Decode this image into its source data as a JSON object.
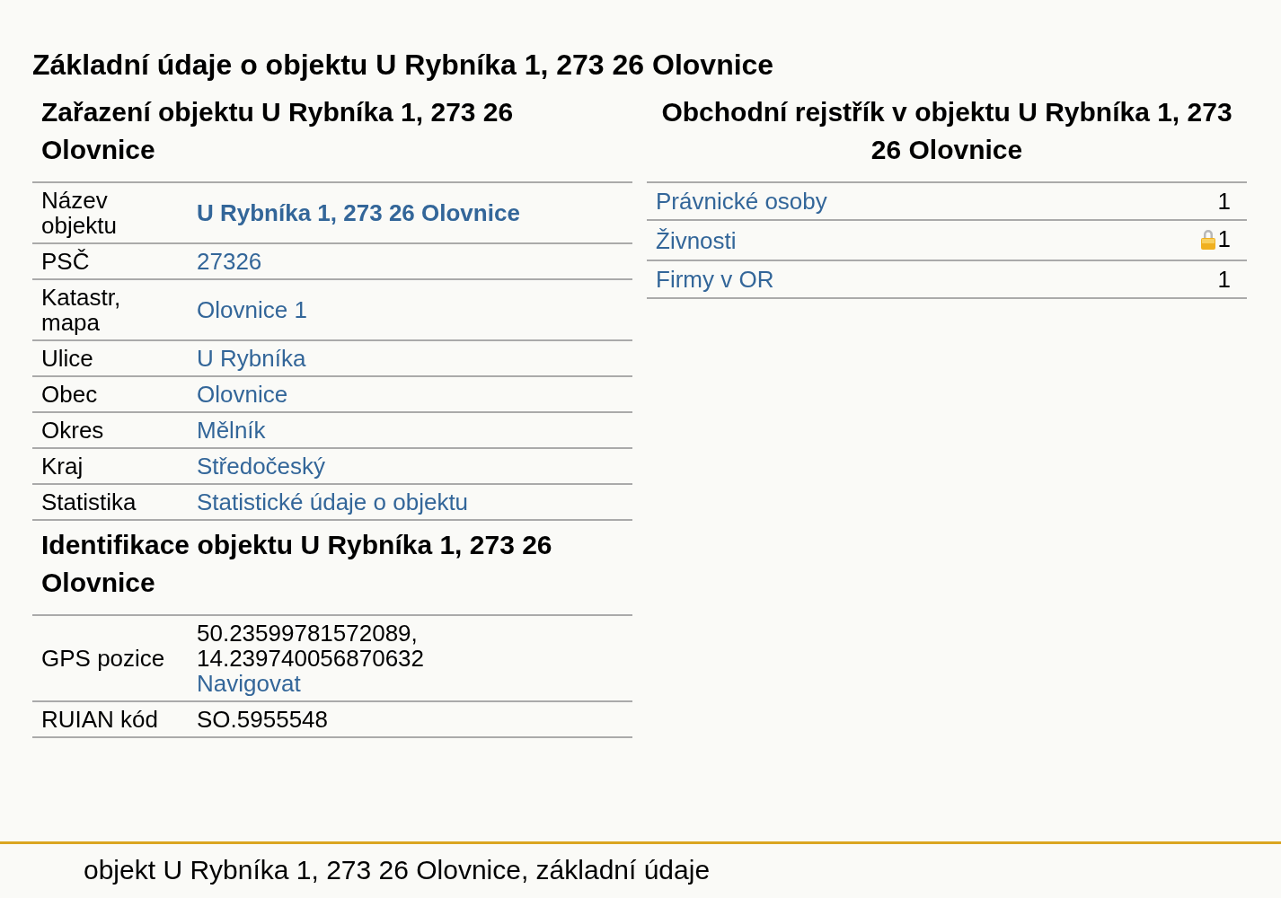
{
  "title": "Základní údaje o objektu U Rybníka 1, 273 26 Olovnice",
  "classification": {
    "heading": "Zařazení objektu U Rybníka 1, 273 26 Olovnice",
    "rows": [
      {
        "label": "Název objektu",
        "kind": "link",
        "bold": true,
        "value": "U Rybníka 1, 273 26 Olovnice"
      },
      {
        "label": "PSČ",
        "kind": "link",
        "bold": false,
        "value": "27326"
      },
      {
        "label": "Katastr, mapa",
        "kind": "link",
        "bold": false,
        "value": "Olovnice 1"
      },
      {
        "label": "Ulice",
        "kind": "link",
        "bold": false,
        "value": "U Rybníka"
      },
      {
        "label": "Obec",
        "kind": "link",
        "bold": false,
        "value": "Olovnice"
      },
      {
        "label": "Okres",
        "kind": "link",
        "bold": false,
        "value": "Mělník"
      },
      {
        "label": "Kraj",
        "kind": "link",
        "bold": false,
        "value": "Středočeský"
      },
      {
        "label": "Statistika",
        "kind": "link",
        "bold": false,
        "value": "Statistické údaje o objektu"
      }
    ]
  },
  "identification": {
    "heading": "Identifikace objektu U Rybníka 1, 273 26 Olovnice",
    "rows": [
      {
        "label": "GPS pozice",
        "kind": "gps",
        "lines": [
          "50.23599781572089,",
          "14.239740056870632"
        ],
        "link": "Navigovat"
      },
      {
        "label": "RUIAN kód",
        "kind": "text",
        "value": "SO.5955548"
      }
    ]
  },
  "business_register": {
    "heading": "Obchodní rejstřík v objektu U Rybníka 1, 273 26 Olovnice",
    "rows": [
      {
        "label": "Právnické osoby",
        "count": "1",
        "locked": false
      },
      {
        "label": "Živnosti",
        "count": "1",
        "locked": true
      },
      {
        "label": "Firmy v OR",
        "count": "1",
        "locked": false
      }
    ]
  },
  "footer": "objekt U Rybníka 1, 273 26 Olovnice, základní údaje"
}
